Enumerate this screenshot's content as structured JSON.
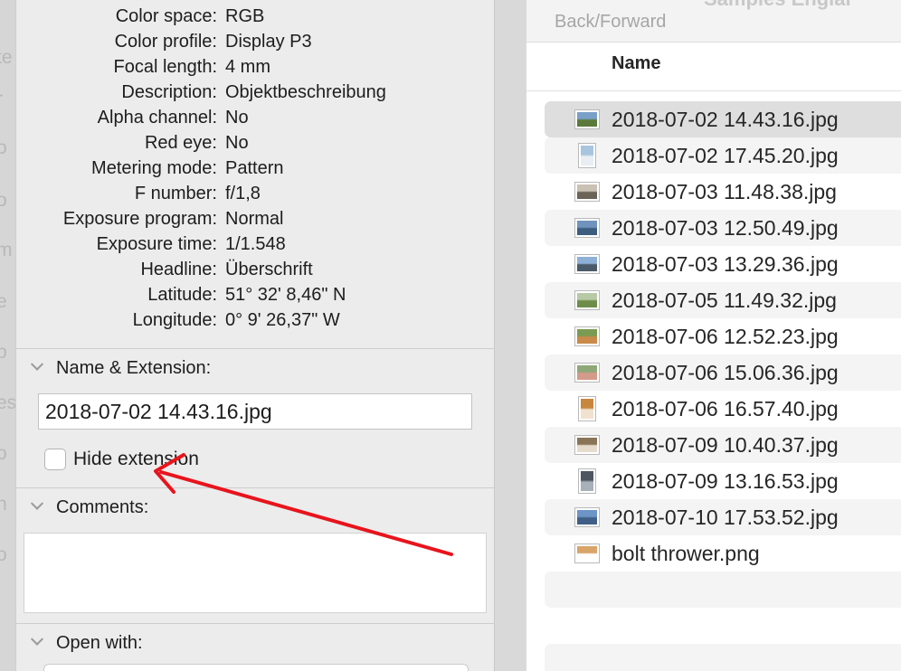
{
  "background_fragments": [
    "te",
    "r",
    "o",
    "o",
    "m",
    "e",
    "p",
    "es",
    "o",
    "n",
    "o"
  ],
  "metadata": [
    {
      "key": "Color space:",
      "value": "RGB"
    },
    {
      "key": "Color profile:",
      "value": "Display P3"
    },
    {
      "key": "Focal length:",
      "value": "4 mm"
    },
    {
      "key": "Description:",
      "value": "Objektbeschreibung"
    },
    {
      "key": "Alpha channel:",
      "value": "No"
    },
    {
      "key": "Red eye:",
      "value": "No"
    },
    {
      "key": "Metering mode:",
      "value": "Pattern"
    },
    {
      "key": "F number:",
      "value": "f/1,8"
    },
    {
      "key": "Exposure program:",
      "value": "Normal"
    },
    {
      "key": "Exposure time:",
      "value": "1/1.548"
    },
    {
      "key": "Headline:",
      "value": "Überschrift"
    },
    {
      "key": "Latitude:",
      "value": "51° 32' 8,46\" N"
    },
    {
      "key": "Longitude:",
      "value": "0° 9' 26,37\" W"
    }
  ],
  "name_extension": {
    "header": "Name & Extension:",
    "value": "2018-07-02 14.43.16.jpg",
    "hide_extension_label": "Hide extension",
    "hide_extension_checked": false
  },
  "comments": {
    "header": "Comments:",
    "value": ""
  },
  "open_with": {
    "header": "Open with:"
  },
  "finder": {
    "title": "Samples Englai",
    "back_forward": "Back/Forward",
    "column_name": "Name",
    "files": [
      {
        "name": "2018-07-02 14.43.16.jpg",
        "thumb": "landscape",
        "colors": [
          "#7aa0c8",
          "#5b7a3a"
        ]
      },
      {
        "name": "2018-07-02 17.45.20.jpg",
        "thumb": "portrait",
        "colors": [
          "#a9c4de",
          "#e8eef4"
        ]
      },
      {
        "name": "2018-07-03 11.48.38.jpg",
        "thumb": "landscape",
        "colors": [
          "#c9c1b4",
          "#6b6258"
        ]
      },
      {
        "name": "2018-07-03 12.50.49.jpg",
        "thumb": "landscape",
        "colors": [
          "#6f93bd",
          "#3c5d7e"
        ]
      },
      {
        "name": "2018-07-03 13.29.36.jpg",
        "thumb": "landscape",
        "colors": [
          "#8fb0d6",
          "#4a5a68"
        ]
      },
      {
        "name": "2018-07-05 11.49.32.jpg",
        "thumb": "landscape",
        "colors": [
          "#b7c9a5",
          "#6e8d4a"
        ]
      },
      {
        "name": "2018-07-06 12.52.23.jpg",
        "thumb": "landscape",
        "colors": [
          "#7a9b52",
          "#c98a4a"
        ]
      },
      {
        "name": "2018-07-06 15.06.36.jpg",
        "thumb": "landscape",
        "colors": [
          "#8fa87a",
          "#d49a8a"
        ]
      },
      {
        "name": "2018-07-06 16.57.40.jpg",
        "thumb": "portrait",
        "colors": [
          "#c9863f",
          "#f0e2cf"
        ]
      },
      {
        "name": "2018-07-09 10.40.37.jpg",
        "thumb": "landscape",
        "colors": [
          "#8a7458",
          "#e6dccd"
        ]
      },
      {
        "name": "2018-07-09 13.16.53.jpg",
        "thumb": "portrait",
        "colors": [
          "#4d5560",
          "#a8b0ba"
        ]
      },
      {
        "name": "2018-07-10 17.53.52.jpg",
        "thumb": "landscape",
        "colors": [
          "#6d94c7",
          "#3f5f86"
        ]
      },
      {
        "name": "bolt thrower.png",
        "thumb": "landscape",
        "colors": [
          "#d8a468",
          "#ffffff"
        ]
      }
    ]
  },
  "annotation": {
    "color": "#e8141c"
  }
}
